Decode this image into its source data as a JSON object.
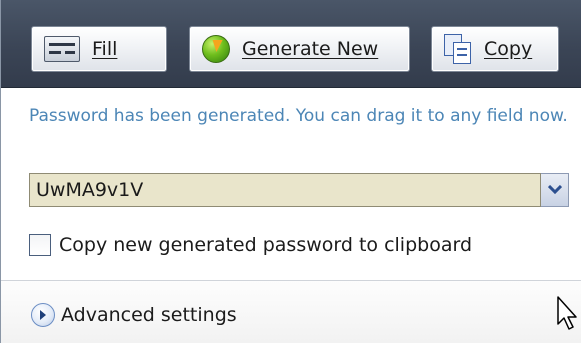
{
  "toolbar": {
    "fill": {
      "label": "Fill",
      "icon": "form-fill-icon"
    },
    "generate": {
      "label": "Generate New",
      "icon": "generate-bolt-icon"
    },
    "copy": {
      "label": "Copy",
      "icon": "copy-documents-icon"
    }
  },
  "message": "Password has been generated. You can drag it to any field now.",
  "password": {
    "value": "UwMA9v1V",
    "dropdown_icon": "chevron-down-icon"
  },
  "clipboard_option": {
    "label": "Copy new generated password to clipboard",
    "checked": false
  },
  "advanced": {
    "label": "Advanced settings",
    "icon": "expand-arrow-icon"
  },
  "colors": {
    "toolbar_bg": "#3b4556",
    "message_text": "#4c86b6",
    "password_field_bg": "#e9e5cb"
  }
}
